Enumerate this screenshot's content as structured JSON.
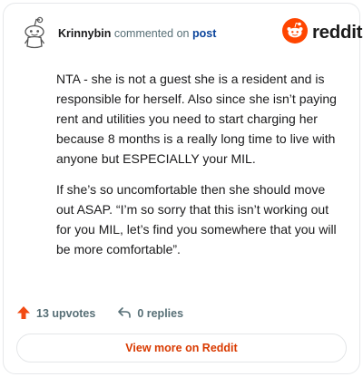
{
  "header": {
    "username": "Krinnybin",
    "action_text": "commented on",
    "link_text": "post",
    "logo_wordmark": "reddit"
  },
  "comment": {
    "paragraphs": [
      "NTA - she is not a guest she is a resident and is responsible for herself. Also since she isn’t paying rent and utilities you need to start charging her because 8 months is a really long time to live with anyone but ESPECIALLY your MIL.",
      "If she’s so uncomfortable then she should move out ASAP. “I’m so sorry that this isn’t working out for you MIL, let’s find you somewhere that you will be more comfortable”."
    ]
  },
  "actions": {
    "upvotes_label": "13 upvotes",
    "replies_label": "0 replies"
  },
  "footer": {
    "view_more_label": "View more on Reddit"
  },
  "colors": {
    "brand_orange": "#ff4500",
    "upvote_arrow": "#f24b14",
    "link_blue": "#0a449b",
    "button_text": "#d93a00"
  },
  "icons": {
    "avatar": "snoo-avatar-icon",
    "logo": "reddit-snoo-logo-icon",
    "upvote": "upvote-arrow-icon",
    "reply": "reply-arrow-icon"
  }
}
